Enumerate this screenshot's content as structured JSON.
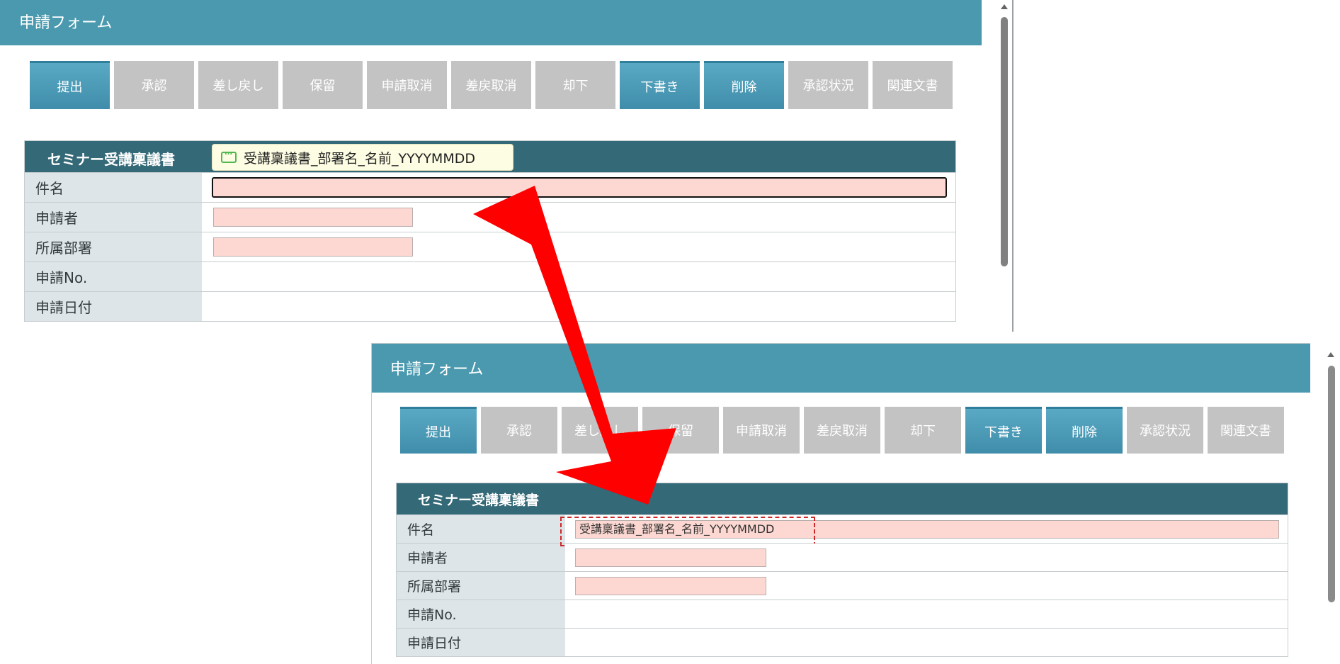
{
  "top": {
    "header_title": "申請フォーム",
    "buttons": [
      {
        "label": "提出",
        "style": "blue"
      },
      {
        "label": "承認",
        "style": "gray"
      },
      {
        "label": "差し戻し",
        "style": "gray"
      },
      {
        "label": "保留",
        "style": "gray"
      },
      {
        "label": "申請取消",
        "style": "gray"
      },
      {
        "label": "差戻取消",
        "style": "gray"
      },
      {
        "label": "却下",
        "style": "gray"
      },
      {
        "label": "下書き",
        "style": "blue"
      },
      {
        "label": "削除",
        "style": "blue"
      },
      {
        "label": "承認状況",
        "style": "gray"
      },
      {
        "label": "関連文書",
        "style": "gray"
      }
    ],
    "form_title": "セミナー受講稟議書",
    "tooltip_text": "受講稟議書_部署名_名前_YYYYMMDD",
    "rows": [
      {
        "label": "件名"
      },
      {
        "label": "申請者"
      },
      {
        "label": "所属部署"
      },
      {
        "label": "申請No."
      },
      {
        "label": "申請日付"
      }
    ]
  },
  "bottom": {
    "header_title": "申請フォーム",
    "buttons": [
      {
        "label": "提出",
        "style": "blue"
      },
      {
        "label": "承認",
        "style": "gray"
      },
      {
        "label": "差し戻し",
        "style": "gray"
      },
      {
        "label": "保留",
        "style": "gray"
      },
      {
        "label": "申請取消",
        "style": "gray"
      },
      {
        "label": "差戻取消",
        "style": "gray"
      },
      {
        "label": "却下",
        "style": "gray"
      },
      {
        "label": "下書き",
        "style": "blue"
      },
      {
        "label": "削除",
        "style": "blue"
      },
      {
        "label": "承認状況",
        "style": "gray"
      },
      {
        "label": "関連文書",
        "style": "gray"
      }
    ],
    "form_title": "セミナー受講稟議書",
    "subject_value": "受講稟議書_部署名_名前_YYYYMMDD",
    "rows": [
      {
        "label": "件名"
      },
      {
        "label": "申請者"
      },
      {
        "label": "所属部署"
      },
      {
        "label": "申請No."
      },
      {
        "label": "申請日付"
      }
    ]
  },
  "colors": {
    "header": "#4a99ae",
    "form_head": "#346977",
    "button_blue": "#3f8daa",
    "button_gray": "#c3c3c3",
    "required_field": "#fdd8d2",
    "arrow": "#ff0000",
    "highlight": "#cc2a2a"
  },
  "icons": {
    "tooltip": "chat-bubble-icon",
    "arrow": "callout-arrow"
  }
}
